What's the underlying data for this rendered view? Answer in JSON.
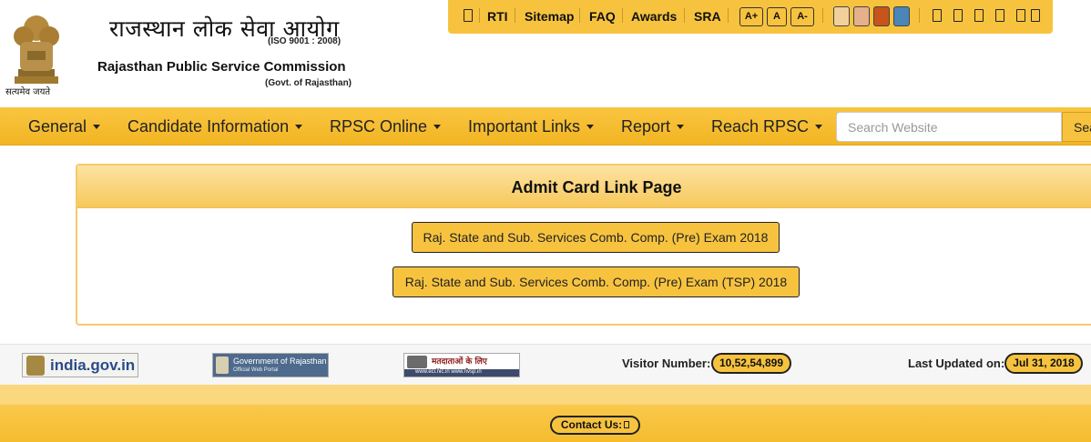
{
  "header": {
    "hindi_title": "राजस्थान लोक सेवा आयोग",
    "iso": "(ISO 9001 : 2008)",
    "english_title": "Rajasthan Public Service Commission",
    "govt": "(Govt. of Rajasthan)",
    "motto": "सत्यमेव जयते"
  },
  "topbar": {
    "home_icon": "home-icon",
    "links": [
      "RTI",
      "Sitemap",
      "FAQ",
      "Awards",
      "SRA"
    ],
    "font_sizes": [
      "A+",
      "A",
      "A-"
    ],
    "themes": [
      "#f2d09a",
      "#e6b08a",
      "#c9541a",
      "#4a86b8"
    ],
    "languages_icons": [
      "lang-icon-1",
      "lang-icon-2",
      "lang-icon-3",
      "lang-icon-4",
      "lang-icon-5",
      "lang-icon-6"
    ]
  },
  "nav": {
    "items": [
      "General",
      "Candidate Information",
      "RPSC Online",
      "Important Links",
      "Report",
      "Reach RPSC"
    ],
    "search_placeholder": "Search Website",
    "search_button": "Search"
  },
  "panel": {
    "title": "Admit Card Link Page",
    "buttons": [
      "Raj. State and Sub. Services Comb. Comp. (Pre) Exam 2018",
      "Raj. State and Sub. Services Comb. Comp. (Pre) Exam (TSP) 2018"
    ]
  },
  "footer": {
    "logos": {
      "india": "india.gov.in",
      "raj": "Government of Rajasthan",
      "raj_sub": "Official Web Portal",
      "voter": "मतदाताओं के लिए ऑनलाइन सेवाएं",
      "voter_sub": "www.eci.nic.in  www.nvsp.in"
    },
    "visitor_label": "Visitor Number:",
    "visitor_number": "10,52,54,899",
    "updated_label": "Last Updated on:",
    "updated_date": "Jul 31, 2018",
    "contact": "Contact Us:"
  }
}
